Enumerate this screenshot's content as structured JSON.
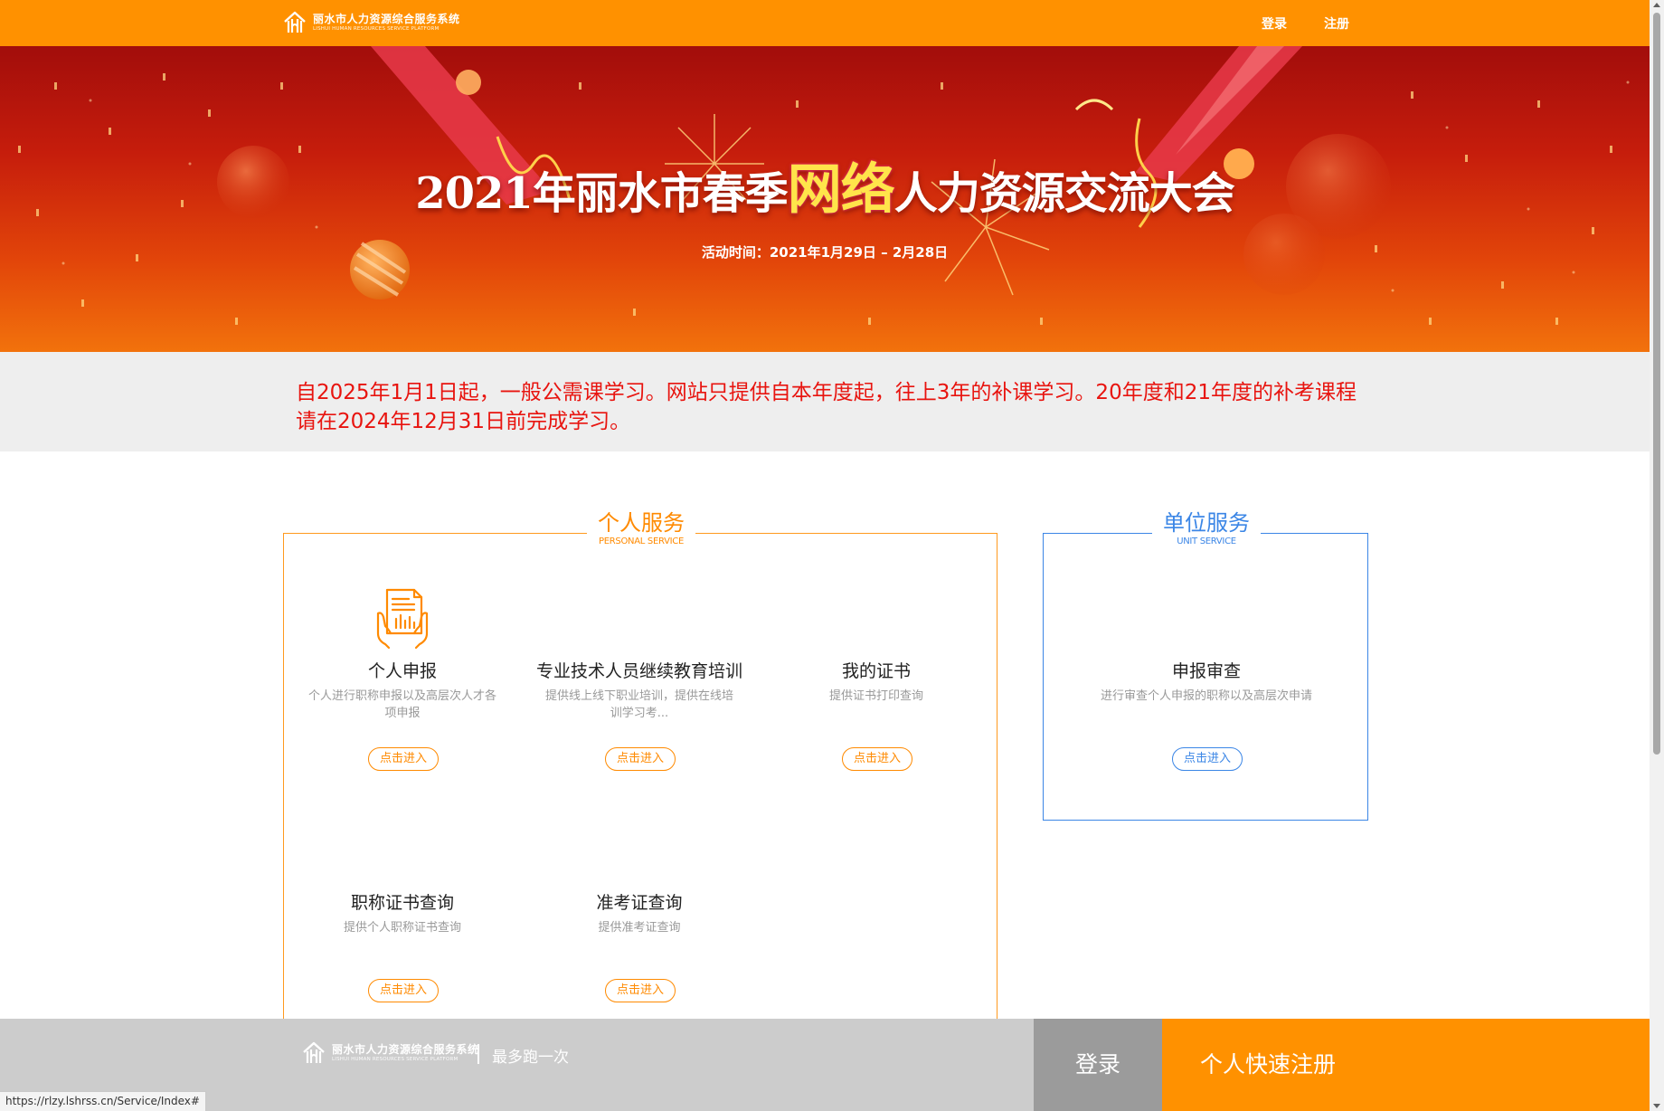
{
  "header": {
    "logo_cn": "丽水市人力资源综合服务系统",
    "logo_en": "LISHUI HUMAN RESOURCES SERVICE PLATFORM",
    "login": "登录",
    "register": "注册"
  },
  "banner": {
    "title_prefix": "2021年丽水市春季",
    "title_highlight": "网络",
    "title_suffix": "人力资源交流大会",
    "date": "活动时间：2021年1月29日 – 2月28日"
  },
  "notice": {
    "text": "自2025年1月1日起，一般公需课学习。网站只提供自本年度起，往上3年的补课学习。20年度和21年度的补考课程请在2024年12月31日前完成学习。"
  },
  "personal": {
    "title": "个人服务",
    "subtitle": "PERSONAL SERVICE",
    "items": [
      {
        "title": "个人申报",
        "desc": "个人进行职称申报以及高层次人才各项申报",
        "button": "点击进入",
        "icon": "document-hands-icon"
      },
      {
        "title": "专业技术人员继续教育培训",
        "desc": "提供线上线下职业培训，提供在线培训学习考...",
        "button": "点击进入"
      },
      {
        "title": "我的证书",
        "desc": "提供证书打印查询",
        "button": "点击进入"
      },
      {
        "title": "职称证书查询",
        "desc": "提供个人职称证书查询",
        "button": "点击进入"
      },
      {
        "title": "准考证查询",
        "desc": "提供准考证查询",
        "button": "点击进入"
      }
    ]
  },
  "unit": {
    "title": "单位服务",
    "subtitle": "UNIT SERVICE",
    "items": [
      {
        "title": "申报审查",
        "desc": "进行审查个人申报的职称以及高层次申请",
        "button": "点击进入"
      }
    ]
  },
  "footer": {
    "logo_cn": "丽水市人力资源综合服务系统",
    "logo_en": "LISHUI HUMAN RESOURCES SERVICE PLATFORM",
    "slogan": "最多跑一次",
    "login": "登录",
    "register": "个人快速注册"
  },
  "status_url": "https://rlzy.lshrss.cn/Service/Index#",
  "colors": {
    "brand_orange": "#ff9100",
    "notice_red": "#e8140f",
    "unit_blue": "#3b86e6",
    "banner_red": "#c61d0c"
  }
}
